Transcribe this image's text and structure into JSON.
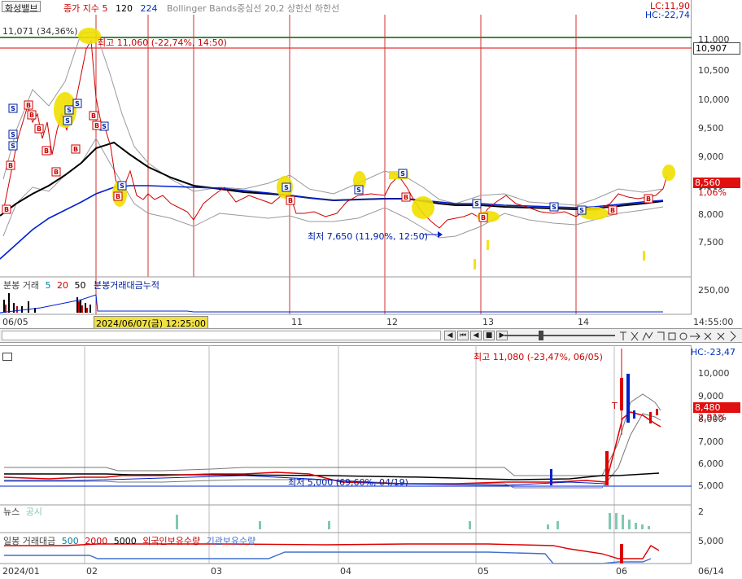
{
  "top": {
    "stock_name": "화성밸브",
    "legend_close": "종가 지수",
    "legend_ma": [
      "5",
      "120",
      "224"
    ],
    "legend_bb": "Bollinger Bands중심선 20,2 상한선 하한선",
    "lc": "LC:11,90",
    "hc": "HC:-22,74",
    "high_ref": "11,071 (34,36%)",
    "high_note": "최고 11,060 (-22,74%, 14:50)",
    "low_note": "최저 7,650 (11,90%, 12:50)",
    "price_tag_top": "10,907",
    "price_tag_cur": "8,560",
    "pct_tag_cur": "1,06%",
    "y_ticks": [
      "11,000",
      "10,500",
      "10,000",
      "9,500",
      "9,000",
      "8,500",
      "8,000",
      "7,500"
    ],
    "volume_legend": [
      "분봉 거래",
      "5",
      "20",
      "50",
      "분봉거래대금누적"
    ],
    "vol_tick": "250,00",
    "time_right": "14:55:00",
    "x_labels": [
      "06/05",
      "11",
      "12",
      "13",
      "14"
    ],
    "cursor_time": "2024/06/07(금) 12:25:00"
  },
  "toolbar": {
    "buttons": [
      "◀",
      "⏮",
      "◀",
      "■",
      "▶"
    ],
    "icon_count": 10
  },
  "bottom": {
    "high_note": "최고 11,080 (-23,47%, 06/05)",
    "hc": "HC:-23,47",
    "low_note": "최저 5,000 (69,60%, 04/19)",
    "y_ticks": [
      "10,000",
      "9,000",
      "8,000",
      "7,000",
      "6,000",
      "5,000"
    ],
    "price_tag_cur": "8,480",
    "pct_tag_cur": "2,91%",
    "news_legend": [
      "뉴스",
      "공시"
    ],
    "news_tick": "2",
    "vol_legend": [
      "일봉 거래대금",
      "500",
      "2000",
      "5000",
      "외국인보유수량",
      "기관보유수량"
    ],
    "vol_tick": "5,000",
    "x_labels": [
      "2024/01",
      "02",
      "03",
      "04",
      "05",
      "06",
      "06/14"
    ]
  }
}
